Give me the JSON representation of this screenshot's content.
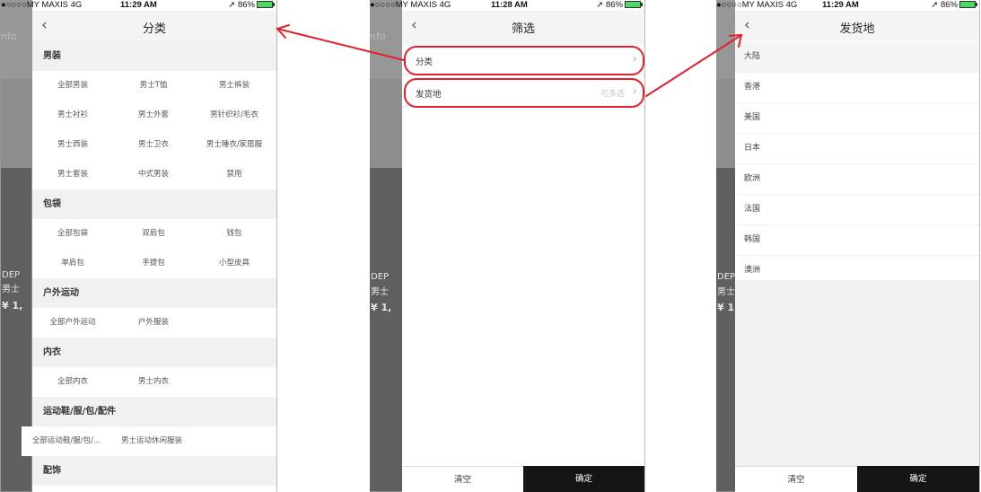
{
  "status_bars": {
    "s1": {
      "carrier": "●○○○○MY MAXIS  4G",
      "time": "11:29 AM",
      "battery": "➚ 86%"
    },
    "s2": {
      "carrier": "●○○○○MY MAXIS  4G",
      "time": "11:28 AM",
      "battery": "➚ 86%"
    },
    "s3": {
      "carrier": "●○○○○MY MAXIS  4G",
      "time": "11:29 AM",
      "battery": "➚ 86%"
    }
  },
  "background_page": {
    "info_label": "nfo",
    "brand_fragment": "DEP",
    "name_fragment": "男士",
    "price_fragment": "¥ 1,"
  },
  "category_screen": {
    "back_icon": "chevron-left-icon",
    "title": "分类",
    "sections": [
      {
        "name": "男装",
        "rows": [
          [
            "全部男装",
            "男士T恤",
            "男士裤装"
          ],
          [
            "男士衬衫",
            "男士外套",
            "男针织衫/毛衣"
          ],
          [
            "男士西装",
            "男士卫衣",
            "男士睡衣/家居服"
          ],
          [
            "男士套装",
            "中式男装",
            "禁用"
          ]
        ]
      },
      {
        "name": "包袋",
        "rows": [
          [
            "全部包袋",
            "双肩包",
            "钱包"
          ],
          [
            "单肩包",
            "手提包",
            "小型皮具"
          ]
        ]
      },
      {
        "name": "户外运动",
        "rows": [
          [
            "全部户外运动",
            "户外服装"
          ]
        ]
      },
      {
        "name": "内衣",
        "rows": [
          [
            "全部内衣",
            "男士内衣"
          ]
        ]
      },
      {
        "name": "运动鞋/服/包/配件",
        "rows": [
          [
            "全部运动鞋/服/包/...",
            "男士运动休闲服装"
          ]
        ]
      },
      {
        "name": "配饰",
        "rows": []
      }
    ]
  },
  "filter_screen": {
    "back_icon": "chevron-left-icon",
    "title": "筛选",
    "rows": [
      {
        "label": "分类",
        "hint": ""
      },
      {
        "label": "发货地",
        "hint": "可多选"
      }
    ],
    "clear_label": "清空",
    "confirm_label": "确定"
  },
  "origin_screen": {
    "back_icon": "chevron-left-icon",
    "title": "发货地",
    "items": [
      "大陆",
      "香港",
      "美国",
      "日本",
      "欧洲",
      "法国",
      "韩国",
      "澳洲"
    ],
    "clear_label": "清空",
    "confirm_label": "确定"
  },
  "annotation_colors": {
    "highlight": "#e0202a"
  }
}
